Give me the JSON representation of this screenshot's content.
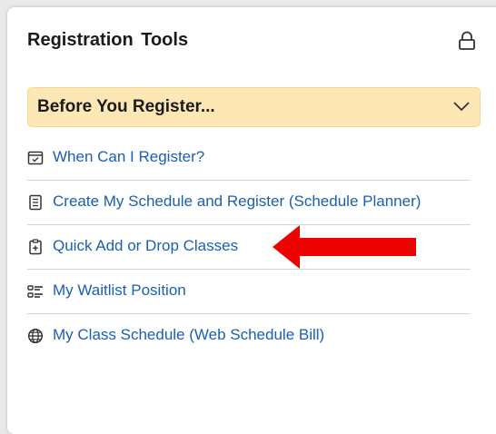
{
  "panel": {
    "title": "Registration Tools",
    "lock_icon": "lock-icon"
  },
  "accordion": {
    "label": "Before You Register...",
    "expanded": true,
    "background_color": "#fde8b5"
  },
  "links": [
    {
      "label": "When Can I Register?",
      "icon": "calendar-icon"
    },
    {
      "label": "Create My Schedule and Register (Schedule Planner)",
      "icon": "document-list-icon"
    },
    {
      "label": "Quick Add or Drop Classes",
      "icon": "clipboard-add-icon"
    },
    {
      "label": "My Waitlist Position",
      "icon": "checklist-icon"
    },
    {
      "label": "My Class Schedule (Web Schedule Bill)",
      "icon": "globe-icon"
    }
  ],
  "colors": {
    "link": "#1b5fae",
    "annotation_arrow": "#ee0000"
  }
}
